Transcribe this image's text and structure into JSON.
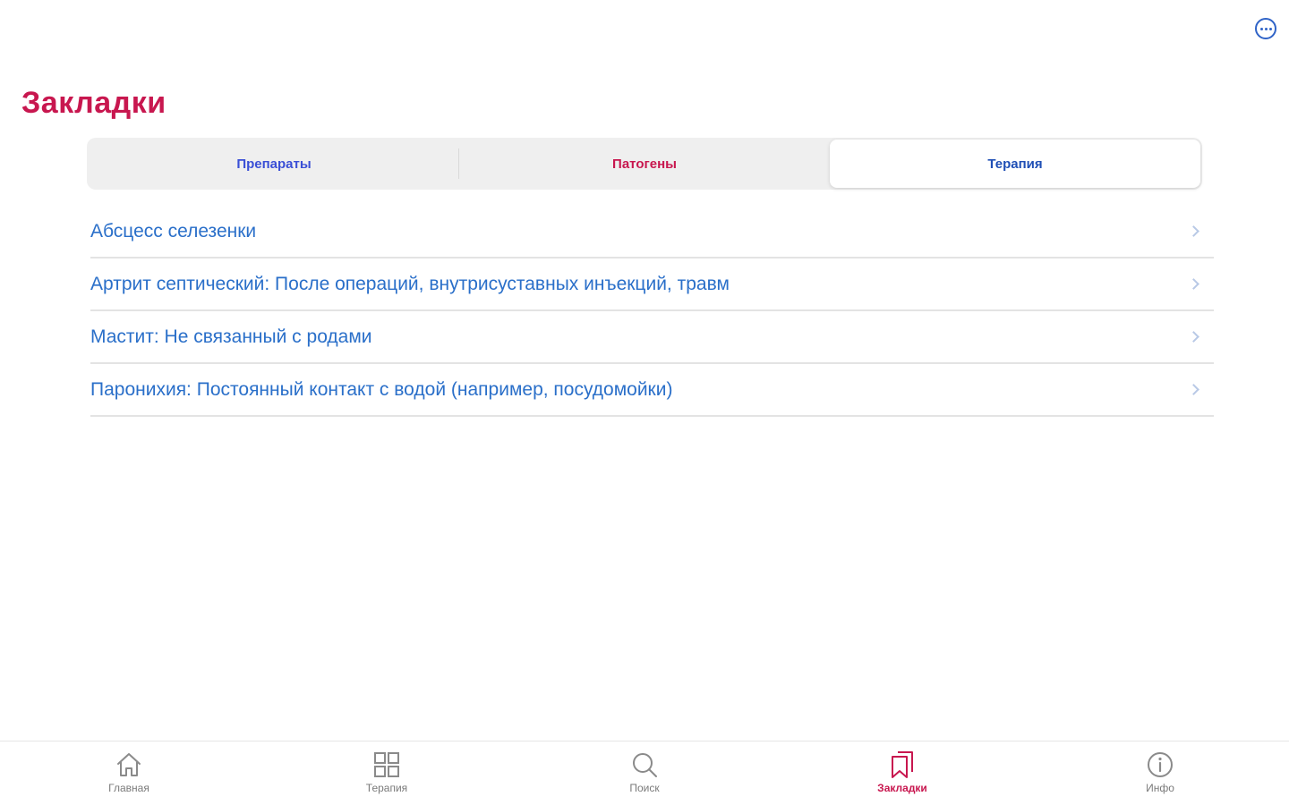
{
  "header": {
    "title": "Закладки",
    "more_icon": "more-icon"
  },
  "segments": [
    {
      "label": "Препараты",
      "color": "#3a4fd6",
      "active": false
    },
    {
      "label": "Патогены",
      "color": "#c8174f",
      "active": false
    },
    {
      "label": "Терапия",
      "color": "#1f4fb5",
      "active": true
    }
  ],
  "bookmarks": [
    {
      "label": "Абсцесс селезенки"
    },
    {
      "label": "Артрит септический: После операций, внутрисуставных инъекций, травм"
    },
    {
      "label": "Мастит: Не связанный с родами"
    },
    {
      "label": "Паронихия: Постоянный контакт с водой (например, посудомойки)"
    }
  ],
  "tabbar": {
    "items": [
      {
        "label": "Главная",
        "icon": "home-icon",
        "active": false
      },
      {
        "label": "Терапия",
        "icon": "grid-icon",
        "active": false
      },
      {
        "label": "Поиск",
        "icon": "search-icon",
        "active": false
      },
      {
        "label": "Закладки",
        "icon": "bookmarks-icon",
        "active": true
      },
      {
        "label": "Инфо",
        "icon": "info-icon",
        "active": false
      }
    ]
  },
  "colors": {
    "accent": "#c8174f",
    "link": "#2a6fc9",
    "inactive": "#7a7a7a"
  }
}
